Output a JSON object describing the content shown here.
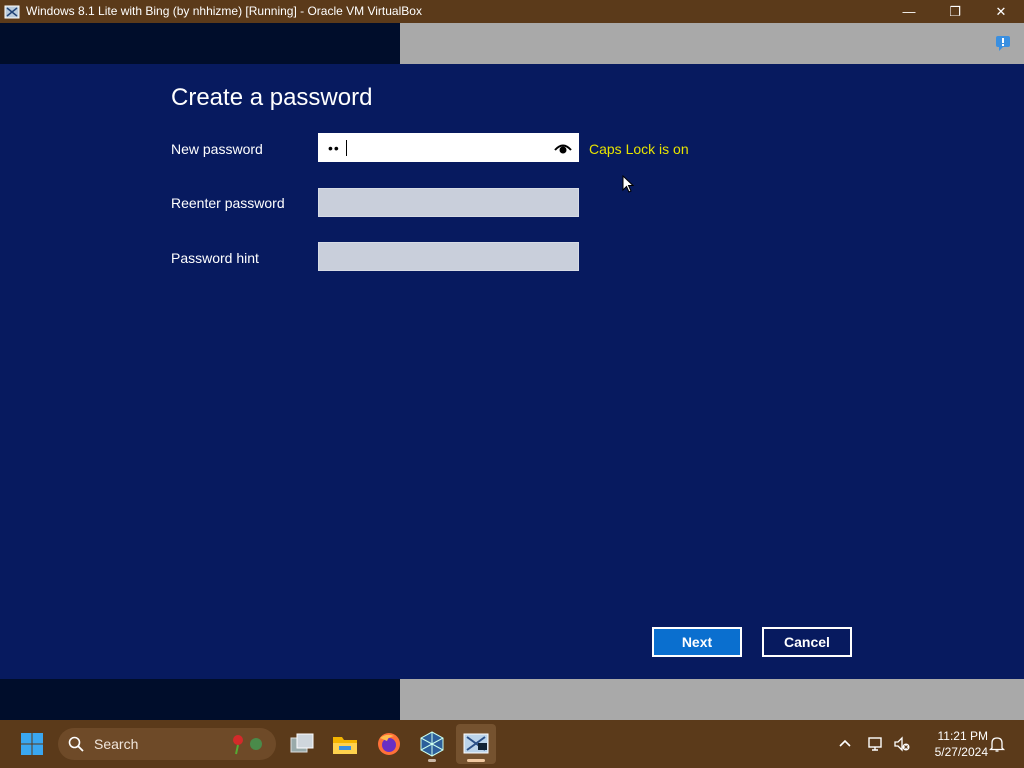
{
  "window": {
    "title": "Windows 8.1 Lite with Bing (by nhhizme) [Running] - Oracle VM VirtualBox",
    "minimize_glyph": "—",
    "restore_glyph": "❐",
    "close_glyph": "✕"
  },
  "dialog": {
    "heading": "Create a password",
    "fields": [
      {
        "label": "New password",
        "value": "••",
        "placeholder": ""
      },
      {
        "label": "Reenter password",
        "value": "",
        "placeholder": ""
      },
      {
        "label": "Password hint",
        "value": "",
        "placeholder": ""
      }
    ],
    "caps_lock_warning": "Caps Lock is on",
    "next_label": "Next",
    "cancel_label": "Cancel"
  },
  "taskbar": {
    "search_label": "Search",
    "time": "11:21 PM",
    "date": "5/27/2024"
  },
  "colors": {
    "vm_background": "#071a5f",
    "accent_button": "#0a6fcf",
    "caps_warning": "#e7e300",
    "host_bar": "#5b3a1a"
  }
}
